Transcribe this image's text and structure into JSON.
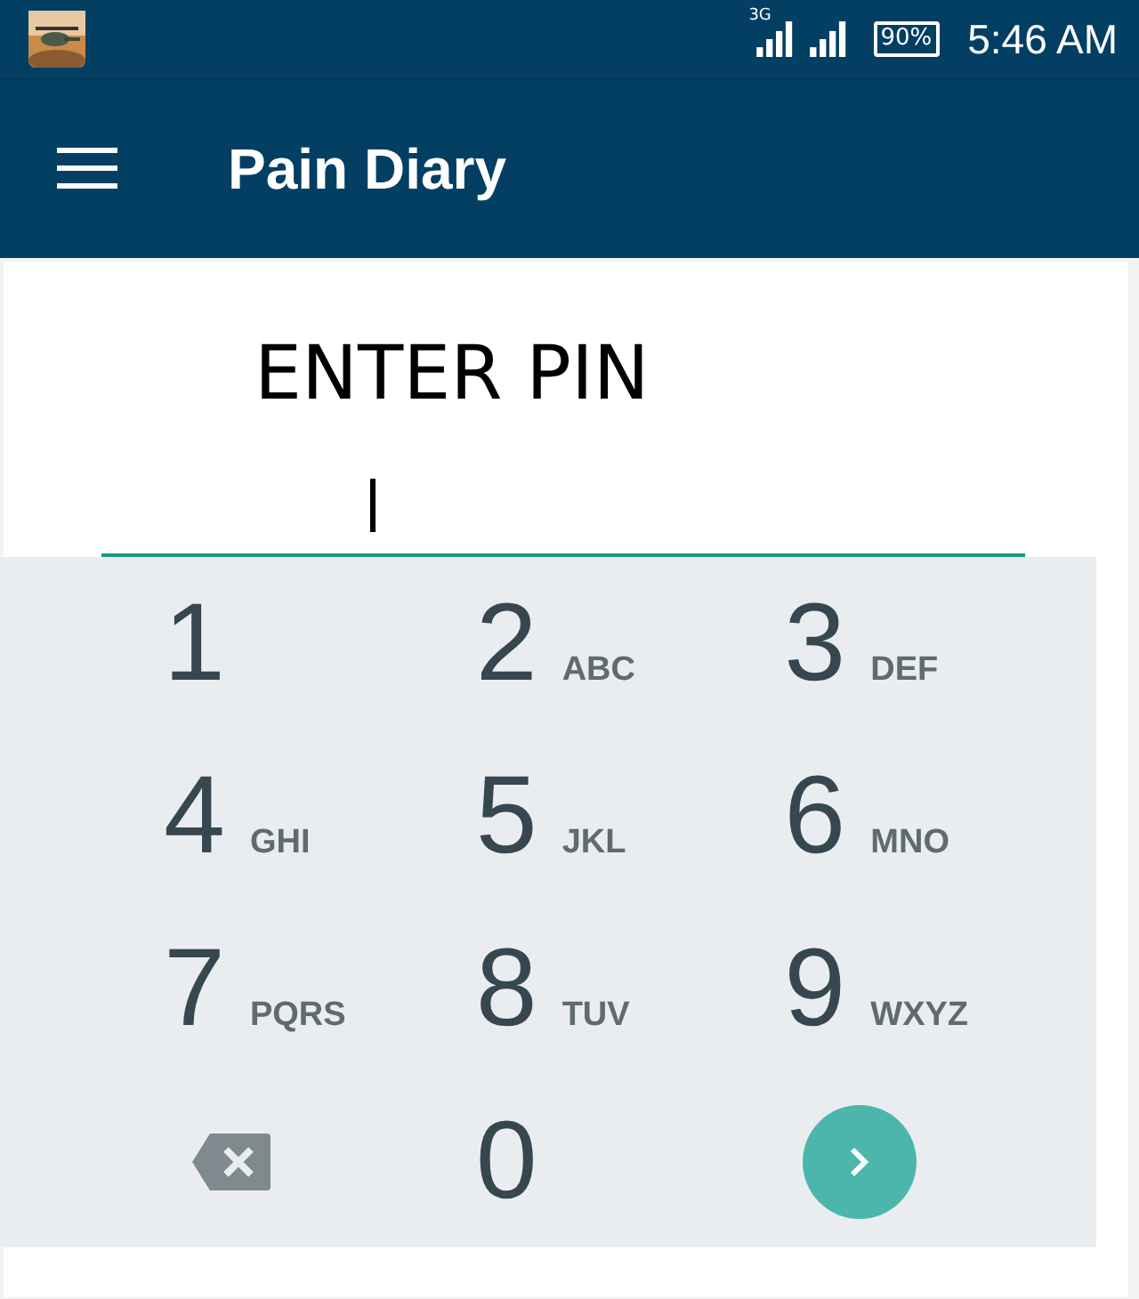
{
  "status_bar": {
    "network": "3G",
    "battery": "90%",
    "time": "5:46 AM"
  },
  "app_bar": {
    "title": "Pain Diary"
  },
  "prompt": "ENTER PIN",
  "keypad": [
    {
      "kind": "digit",
      "digit": "1"
    },
    {
      "kind": "digit",
      "digit": "2",
      "letters": "ABC"
    },
    {
      "kind": "digit",
      "digit": "3",
      "letters": "DEF"
    },
    {
      "kind": "digit",
      "digit": "4",
      "letters": "GHI"
    },
    {
      "kind": "digit",
      "digit": "5",
      "letters": "JKL"
    },
    {
      "kind": "digit",
      "digit": "6",
      "letters": "MNO"
    },
    {
      "kind": "digit",
      "digit": "7",
      "letters": "PQRS"
    },
    {
      "kind": "digit",
      "digit": "8",
      "letters": "TUV"
    },
    {
      "kind": "digit",
      "digit": "9",
      "letters": "WXYZ"
    },
    {
      "kind": "backspace"
    },
    {
      "kind": "digit",
      "digit": "0"
    },
    {
      "kind": "enter"
    }
  ]
}
